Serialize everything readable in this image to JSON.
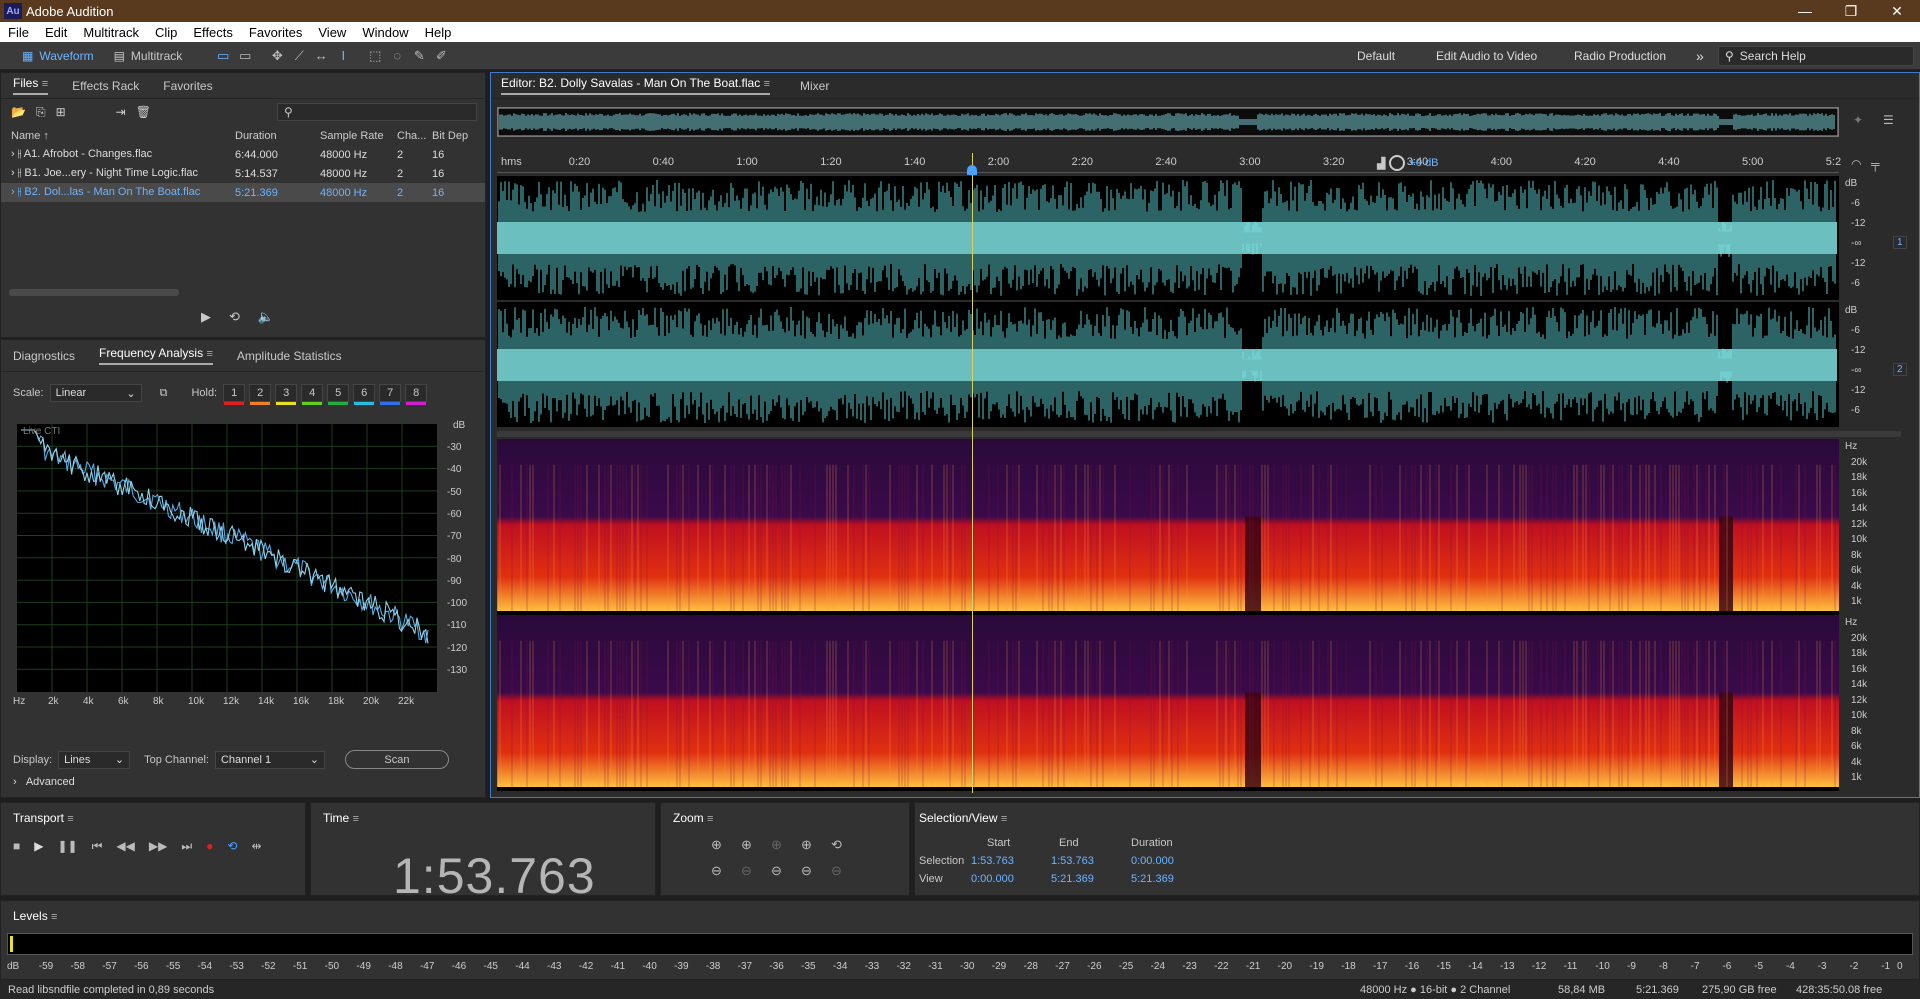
{
  "app": {
    "title": "Adobe Audition",
    "logo_text": "Au"
  },
  "menu": [
    "File",
    "Edit",
    "Multitrack",
    "Clip",
    "Effects",
    "Favorites",
    "View",
    "Window",
    "Help"
  ],
  "toolbar": {
    "waveform_label": "Waveform",
    "multitrack_label": "Multitrack"
  },
  "workspaces": {
    "default": "Default",
    "edit_audio": "Edit Audio to Video",
    "radio": "Radio Production",
    "more": "»",
    "search_placeholder": "Search Help"
  },
  "files_panel": {
    "tabs": [
      "Files",
      "Effects Rack",
      "Favorites"
    ],
    "columns": [
      "Name ↑",
      "Duration",
      "Sample Rate",
      "Cha...",
      "Bit Dep"
    ],
    "rows": [
      {
        "name": "A1. Afrobot - Changes.flac",
        "duration": "6:44.000",
        "rate": "48000 Hz",
        "ch": "2",
        "bit": "16"
      },
      {
        "name": "B1. Joe...ery - Night Time Logic.flac",
        "duration": "5:14.537",
        "rate": "48000 Hz",
        "ch": "2",
        "bit": "16"
      },
      {
        "name": "B2. Dol...las - Man On The Boat.flac",
        "duration": "5:21.369",
        "rate": "48000 Hz",
        "ch": "2",
        "bit": "16"
      }
    ]
  },
  "analysis_panel": {
    "tabs": [
      "Diagnostics",
      "Frequency Analysis",
      "Amplitude Statistics"
    ],
    "scale_label": "Scale:",
    "scale_value": "Linear",
    "hold_label": "Hold:",
    "holds": [
      "1",
      "2",
      "3",
      "4",
      "5",
      "6",
      "7",
      "8"
    ],
    "hold_colors": [
      "#e02020",
      "#f08020",
      "#e8e020",
      "#60d020",
      "#20b040",
      "#20c0e0",
      "#3070f0",
      "#d020d0"
    ],
    "live_label": "Live CTI",
    "db_label": "dB",
    "db_ticks": [
      "-30",
      "-40",
      "-50",
      "-60",
      "-70",
      "-80",
      "-90",
      "-100",
      "-110",
      "-120",
      "-130"
    ],
    "hz_ticks": [
      "Hz",
      "2k",
      "4k",
      "6k",
      "8k",
      "10k",
      "12k",
      "14k",
      "16k",
      "18k",
      "20k",
      "22k"
    ],
    "display_label": "Display:",
    "display_value": "Lines",
    "top_channel_label": "Top Channel:",
    "top_channel_value": "Channel 1",
    "scan_label": "Scan",
    "advanced_label": "Advanced"
  },
  "editor": {
    "tab_label": "Editor: B2. Dolly Savalas - Man On The Boat.flac",
    "mixer_label": "Mixer",
    "ruler": [
      "hms",
      "0:20",
      "0:40",
      "1:00",
      "1:20",
      "1:40",
      "2:00",
      "2:20",
      "2:40",
      "3:00",
      "3:20",
      "3:40",
      "4:00",
      "4:20",
      "4:40",
      "5:00",
      "5:2"
    ],
    "hud_gain": "+0 dB",
    "db_scale": [
      "dB",
      "-6",
      "-12",
      "-∞",
      "-12",
      "-6"
    ],
    "hz_scale": [
      "Hz",
      "20k",
      "18k",
      "16k",
      "14k",
      "12k",
      "10k",
      "8k",
      "6k",
      "4k",
      "1k"
    ],
    "channel1": "1",
    "channel2": "2",
    "playhead_fraction": 0.354
  },
  "transport": {
    "title": "Transport"
  },
  "time": {
    "title": "Time",
    "value": "1:53.763"
  },
  "zoom": {
    "title": "Zoom"
  },
  "selection": {
    "title": "Selection/View",
    "col_start": "Start",
    "col_end": "End",
    "col_duration": "Duration",
    "row_sel": "Selection",
    "sel_start": "1:53.763",
    "sel_end": "1:53.763",
    "sel_dur": "0:00.000",
    "row_view": "View",
    "view_start": "0:00.000",
    "view_end": "5:21.369",
    "view_dur": "5:21.369"
  },
  "levels": {
    "title": "Levels",
    "ticks": [
      "dB",
      "-59",
      "-58",
      "-57",
      "-56",
      "-55",
      "-54",
      "-53",
      "-52",
      "-51",
      "-50",
      "-49",
      "-48",
      "-47",
      "-46",
      "-45",
      "-44",
      "-43",
      "-42",
      "-41",
      "-40",
      "-39",
      "-38",
      "-37",
      "-36",
      "-35",
      "-34",
      "-33",
      "-32",
      "-31",
      "-30",
      "-29",
      "-28",
      "-27",
      "-26",
      "-25",
      "-24",
      "-23",
      "-22",
      "-21",
      "-20",
      "-19",
      "-18",
      "-17",
      "-16",
      "-15",
      "-14",
      "-13",
      "-12",
      "-11",
      "-10",
      "-9",
      "-8",
      "-7",
      "-6",
      "-5",
      "-4",
      "-3",
      "-2",
      "-1",
      "0"
    ]
  },
  "status": {
    "left": "Read libsndfile completed in 0,89 seconds",
    "format": "48000 Hz ● 16-bit ● 2 Channel",
    "size": "58,84 MB",
    "duration": "5:21.369",
    "free": "275,90 GB free",
    "free_time": "428:35:50.08 free"
  }
}
